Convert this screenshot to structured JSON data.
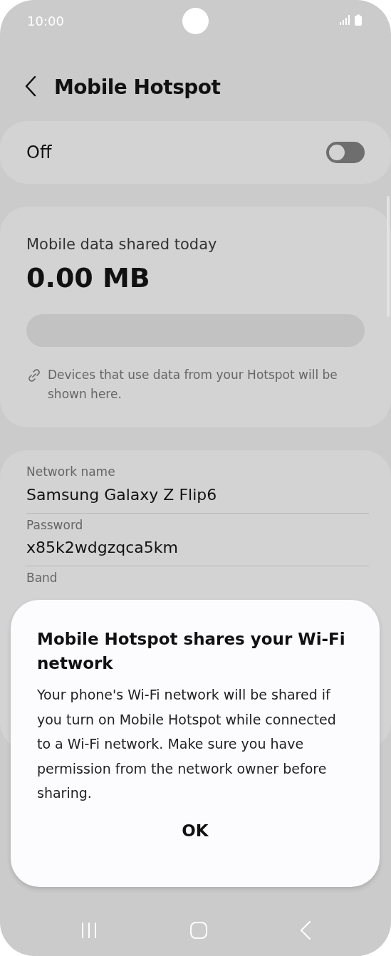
{
  "status_bar": {
    "time": "10:00"
  },
  "header": {
    "title": "Mobile Hotspot"
  },
  "hotspot_toggle": {
    "label": "Off",
    "on": false
  },
  "usage": {
    "label": "Mobile data shared today",
    "amount": "0.00 MB",
    "level": 0,
    "note": "Devices that use data from your Hotspot will be shown here."
  },
  "network": [
    {
      "label": "Network name",
      "value": "Samsung Galaxy Z Flip6"
    },
    {
      "label": "Password",
      "value": "x85k2wdgzqca5km"
    },
    {
      "label": "Band"
    }
  ],
  "dialog": {
    "title": "Mobile Hotspot shares your Wi-Fi network",
    "message": "Your phone's Wi-Fi network will be shared if you turn on Mobile Hotspot while connected to a Wi-Fi network. Make sure you have permission from the network owner before sharing.",
    "button": "OK"
  }
}
